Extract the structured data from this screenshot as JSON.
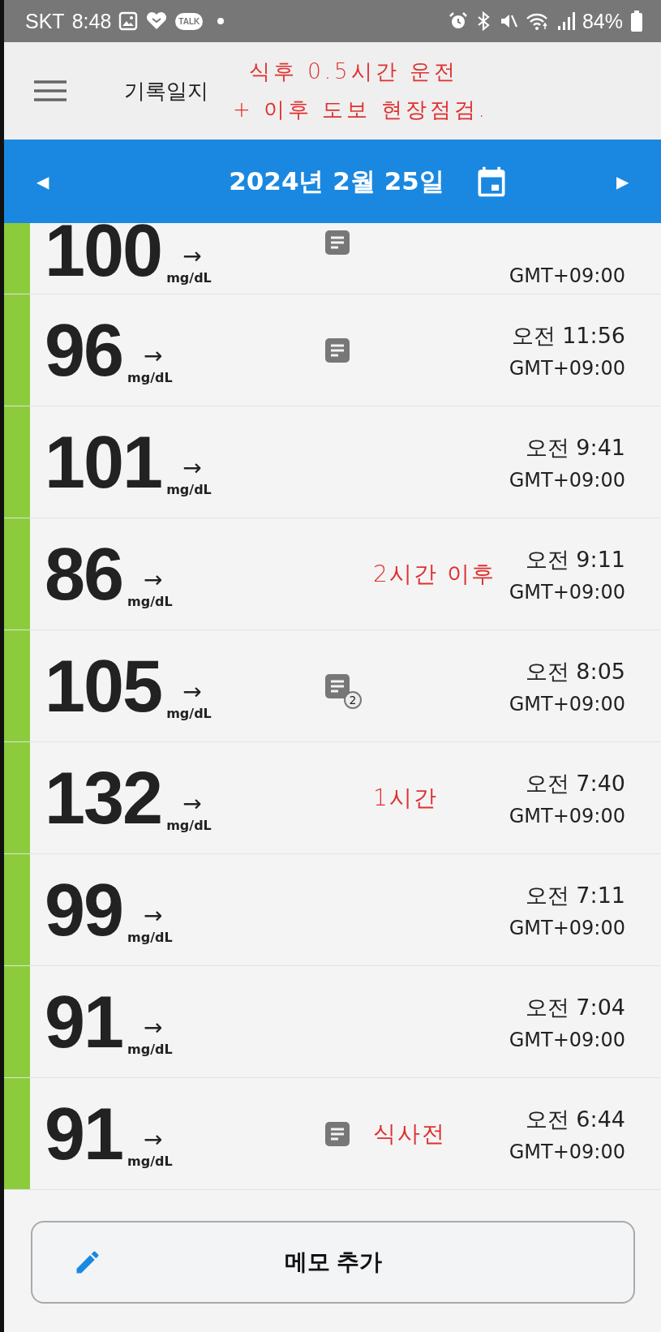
{
  "status_bar": {
    "carrier": "SKT",
    "time": "8:48",
    "talk_badge": "TALK",
    "battery": "84%"
  },
  "header": {
    "title": "기록일지",
    "annotations": [
      "식후 0.5시간 운전",
      "+ 이후 도보 현장점검."
    ]
  },
  "date_bar": {
    "previous": "◀",
    "date": "2024년 2월 25일",
    "next": "▶"
  },
  "readings": [
    {
      "value": "100",
      "trend": "→",
      "unit": "mg/dL",
      "memo": true,
      "timezone": "GMT+09:00"
    },
    {
      "value": "96",
      "trend": "→",
      "unit": "mg/dL",
      "memo": true,
      "time": "오전 11:56",
      "timezone": "GMT+09:00"
    },
    {
      "value": "101",
      "trend": "→",
      "unit": "mg/dL",
      "memo": false,
      "time": "오전 9:41",
      "timezone": "GMT+09:00"
    },
    {
      "value": "86",
      "trend": "→",
      "unit": "mg/dL",
      "memo": false,
      "annotation": "2시간 이후",
      "time": "오전 9:11",
      "timezone": "GMT+09:00"
    },
    {
      "value": "105",
      "trend": "→",
      "unit": "mg/dL",
      "memo": true,
      "memo_count": "2",
      "time": "오전 8:05",
      "timezone": "GMT+09:00"
    },
    {
      "value": "132",
      "trend": "→",
      "unit": "mg/dL",
      "memo": false,
      "annotation": "1시간",
      "time": "오전 7:40",
      "timezone": "GMT+09:00"
    },
    {
      "value": "99",
      "trend": "→",
      "unit": "mg/dL",
      "memo": false,
      "time": "오전 7:11",
      "timezone": "GMT+09:00"
    },
    {
      "value": "91",
      "trend": "→",
      "unit": "mg/dL",
      "memo": false,
      "time": "오전 7:04",
      "timezone": "GMT+09:00"
    },
    {
      "value": "91",
      "trend": "→",
      "unit": "mg/dL",
      "memo": true,
      "annotation": "식사전",
      "time": "오전 6:44",
      "timezone": "GMT+09:00"
    }
  ],
  "add_memo_button": {
    "label": "메모 추가"
  }
}
